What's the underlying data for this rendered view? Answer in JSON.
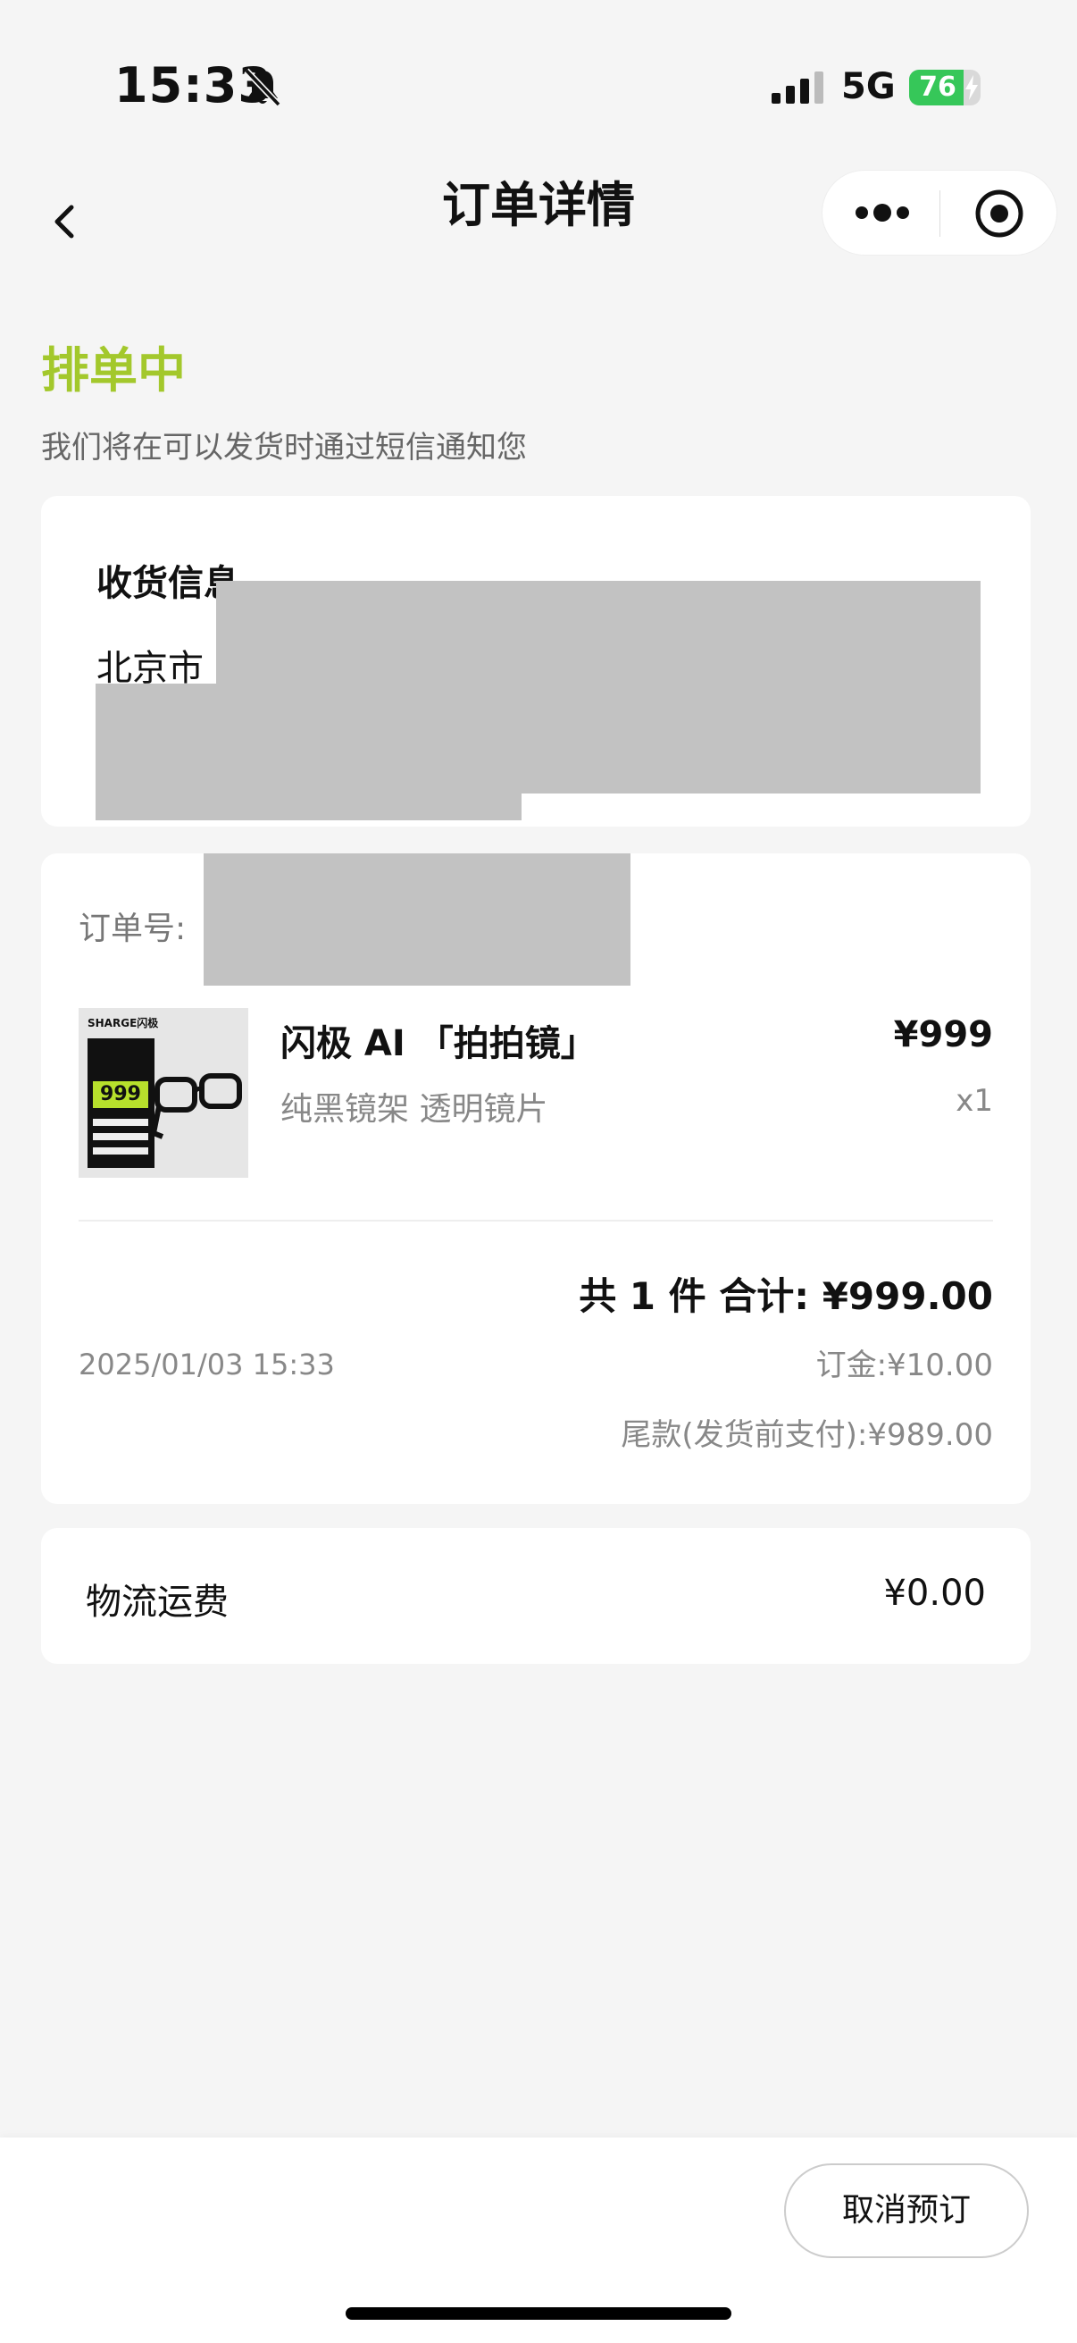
{
  "status_bar": {
    "time": "15:33",
    "network": "5G",
    "battery_level": "76",
    "battery_fraction": 0.76,
    "battery_color": "#36c759"
  },
  "nav": {
    "title": "订单详情"
  },
  "order_status": {
    "title": "排单中",
    "subtitle": "我们将在可以发货时通过短信通知您",
    "color": "#a3c82c"
  },
  "address": {
    "title": "收货信息",
    "city": "北京市"
  },
  "order": {
    "number_label": "订单号:",
    "product_thumb_brand": "SHARGE闪极",
    "product_thumb_price": "999",
    "product_name": "闪极 AI 「拍拍镜」",
    "product_variant": "纯黑镜架 透明镜片",
    "product_price": "¥999",
    "product_qty": "x1",
    "total": "共 1 件 合计: ¥999.00",
    "date": "2025/01/03 15:33",
    "deposit": "订金:¥10.00",
    "balance": "尾款(发货前支付):¥989.00"
  },
  "shipping": {
    "label": "物流运费",
    "value": "¥0.00"
  },
  "actions": {
    "cancel_label": "取消预订"
  }
}
